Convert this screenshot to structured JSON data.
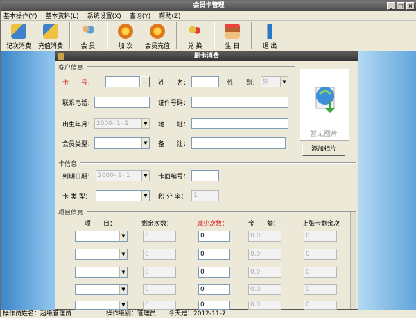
{
  "window": {
    "title": "会员卡管理"
  },
  "menu": [
    "基本操作(Y)",
    "基本资料(L)",
    "系统设置(X)",
    "查询(Y)",
    "帮助(Z)"
  ],
  "toolbar": [
    {
      "label": "记次消费",
      "icon": "card-consume-icon",
      "color": "#3f82c9"
    },
    {
      "label": "充值消费",
      "icon": "recharge-consume-icon",
      "color": "#e0a020"
    },
    {
      "label": "会 员",
      "icon": "members-icon",
      "color": "#5aa0d8"
    },
    {
      "label": "加 次",
      "icon": "add-count-icon",
      "color": "#e07818"
    },
    {
      "label": "会员充值",
      "icon": "member-recharge-icon",
      "color": "#e07818"
    },
    {
      "label": "兑 换",
      "icon": "exchange-icon",
      "color": "#d84040"
    },
    {
      "label": "生 日",
      "icon": "birthday-icon",
      "color": "#b86030"
    },
    {
      "label": "退 出",
      "icon": "exit-icon",
      "color": "#2a78c8"
    }
  ],
  "dialog": {
    "title": "刷卡消费",
    "customer": {
      "group_label": "客户信息",
      "card_no_label": "卡　　号：",
      "browse_label": "...",
      "name_label": "姓　　名：",
      "gender_label": "性　　别：",
      "gender_value": "男",
      "phone_label": "联系电话：",
      "id_label": "证件号码：",
      "birth_label": "出生年月：",
      "birth_value": "2000- 1- 1",
      "address_label": "地　　址：",
      "type_label": "会员类型：",
      "note_label": "备　　注："
    },
    "photo": {
      "placeholder": "暂无图片",
      "add_button": "添加相片"
    },
    "card": {
      "group_label": "卡信息",
      "expiry_label": "到期日期：",
      "expiry_value": "2000- 1- 1",
      "face_label": "卡面编号：",
      "type_label": "卡 类 型：",
      "points_label": "积 分 率：",
      "points_value": "1"
    },
    "items": {
      "group_label": "项目信息",
      "col_item": "项　　目：",
      "col_remaining": "剩余次数：",
      "col_reduce": "减少次数：",
      "col_amount": "金　　额：",
      "col_last": "上张卡剩余次",
      "rows": [
        {
          "remaining": "0",
          "reduce": "0",
          "amount": "0.0",
          "last": "0"
        },
        {
          "remaining": "0",
          "reduce": "0",
          "amount": "0.0",
          "last": "0"
        },
        {
          "remaining": "0",
          "reduce": "0",
          "amount": "0.0",
          "last": "0"
        },
        {
          "remaining": "0",
          "reduce": "0",
          "amount": "0.0",
          "last": "0"
        },
        {
          "remaining": "0",
          "reduce": "0",
          "amount": "0.0",
          "last": "0"
        }
      ]
    }
  },
  "status": {
    "operator": "操作员姓名：超级管理员",
    "level": "操作级别：管理员",
    "today": "今天是：2012-11-7"
  }
}
